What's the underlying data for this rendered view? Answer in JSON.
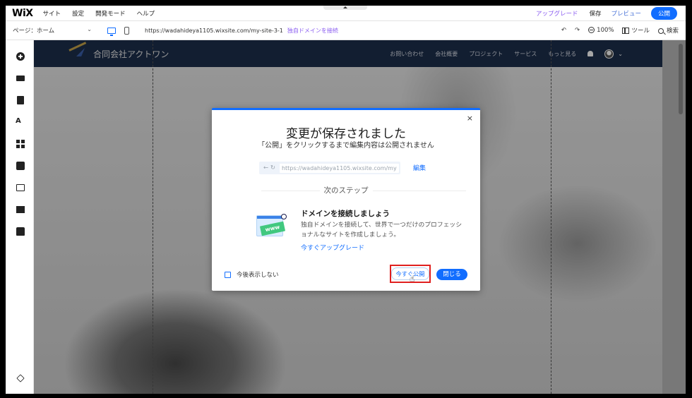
{
  "topbar": {
    "logo": "WiX",
    "menu": [
      "サイト",
      "設定",
      "開発モード",
      "ヘルプ"
    ],
    "upgrade": "アップグレード",
    "save": "保存",
    "preview": "プレビュー",
    "publish": "公開"
  },
  "secondbar": {
    "page_selector": "ページ：ホーム",
    "url": "https://wadahideya1105.wixsite.com/my-site-3-1",
    "connect_domain": "独自ドメインを接続",
    "zoom": "100%",
    "tools": "ツール",
    "search": "検索"
  },
  "sidebar": {
    "icons": [
      "add-icon",
      "sections-icon",
      "pages-icon",
      "design-icon",
      "apps-icon",
      "business-icon",
      "media-icon",
      "cms-icon",
      "store-icon",
      "layers-icon"
    ]
  },
  "site": {
    "name": "合同会社アクトワン",
    "nav": [
      "お問い合わせ",
      "会社概要",
      "プロジェクト",
      "サービス",
      "もっと見る"
    ]
  },
  "modal": {
    "close": "×",
    "title": "変更が保存されました",
    "subtitle": "「公開」をクリックするまで編集内容は公開されません",
    "url_preview": "https://wadahideya1105.wixsite.com/my",
    "edit": "編集",
    "next_steps": "次のステップ",
    "promo_badge": "www",
    "promo_title": "ドメインを接続しましょう",
    "promo_desc": "独自ドメインを接続して、世界で一つだけのプロフェッショナルなサイトを作成しましょう。",
    "promo_link": "今すぐアップグレード",
    "dont_show": "今後表示しない",
    "publish_now": "今すぐ公開",
    "close_btn": "閉じる"
  },
  "colors": {
    "accent": "#116dff",
    "upgrade": "#8a5cf0",
    "site_header": "#1d2f4c",
    "highlight": "#e0201f"
  }
}
